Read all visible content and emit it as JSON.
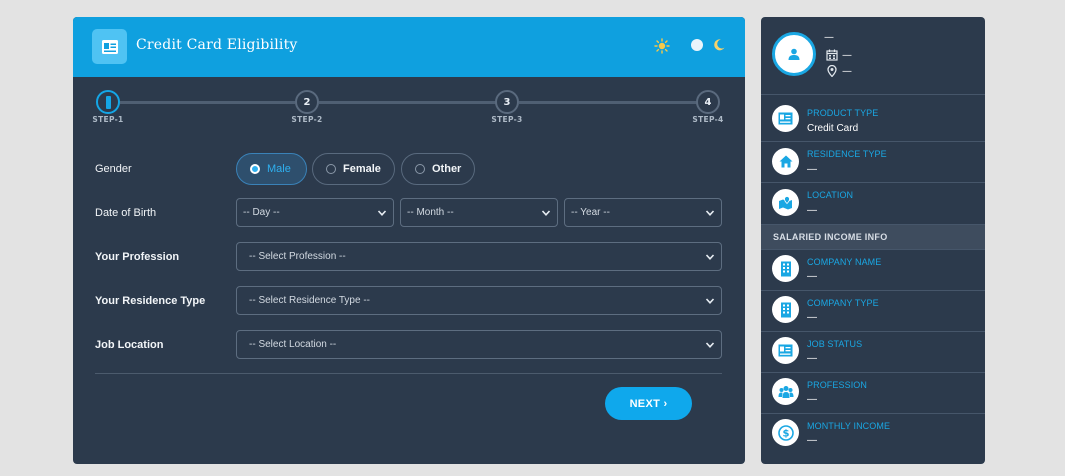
{
  "header": {
    "title": "Credit Card Eligibility",
    "icon": "id-card-icon",
    "accent": "#0fa0df"
  },
  "stepper": {
    "steps": [
      {
        "number": "1",
        "label": "STEP-1",
        "active": true
      },
      {
        "number": "2",
        "label": "STEP-2"
      },
      {
        "number": "3",
        "label": "STEP-3"
      },
      {
        "number": "4",
        "label": "STEP-4"
      }
    ]
  },
  "form": {
    "gender": {
      "label": "Gender",
      "options": [
        "Male",
        "Female",
        "Other"
      ],
      "selected": "Male"
    },
    "dob": {
      "label": "Date of Birth",
      "day": "-- Day --",
      "month": "-- Month --",
      "year": "-- Year --"
    },
    "profession": {
      "label": "Your Profession",
      "value": "-- Select Profession --"
    },
    "residence": {
      "label": "Your Residence Type",
      "value": "-- Select Residence Type --"
    },
    "location": {
      "label": "Job Location",
      "value": "-- Select Location --"
    },
    "next_label": "NEXT ›"
  },
  "summary": {
    "profile": {
      "name": "—",
      "dob": "—",
      "location": "—"
    },
    "items": [
      {
        "title": "PRODUCT TYPE",
        "value": "Credit Card",
        "icon": "id-card-icon"
      },
      {
        "title": "RESIDENCE TYPE",
        "value": "—",
        "icon": "home-icon"
      },
      {
        "title": "LOCATION",
        "value": "—",
        "icon": "map-icon"
      }
    ],
    "section_title": "SALARIED INCOME INFO",
    "income_items": [
      {
        "title": "COMPANY NAME",
        "value": "—",
        "icon": "building-icon"
      },
      {
        "title": "COMPANY TYPE",
        "value": "—",
        "icon": "building-icon"
      },
      {
        "title": "JOB STATUS",
        "value": "—",
        "icon": "id-card-icon"
      },
      {
        "title": "PROFESSION",
        "value": "—",
        "icon": "users-icon"
      },
      {
        "title": "MONTHLY INCOME",
        "value": "—",
        "icon": "dollar-icon"
      }
    ]
  }
}
